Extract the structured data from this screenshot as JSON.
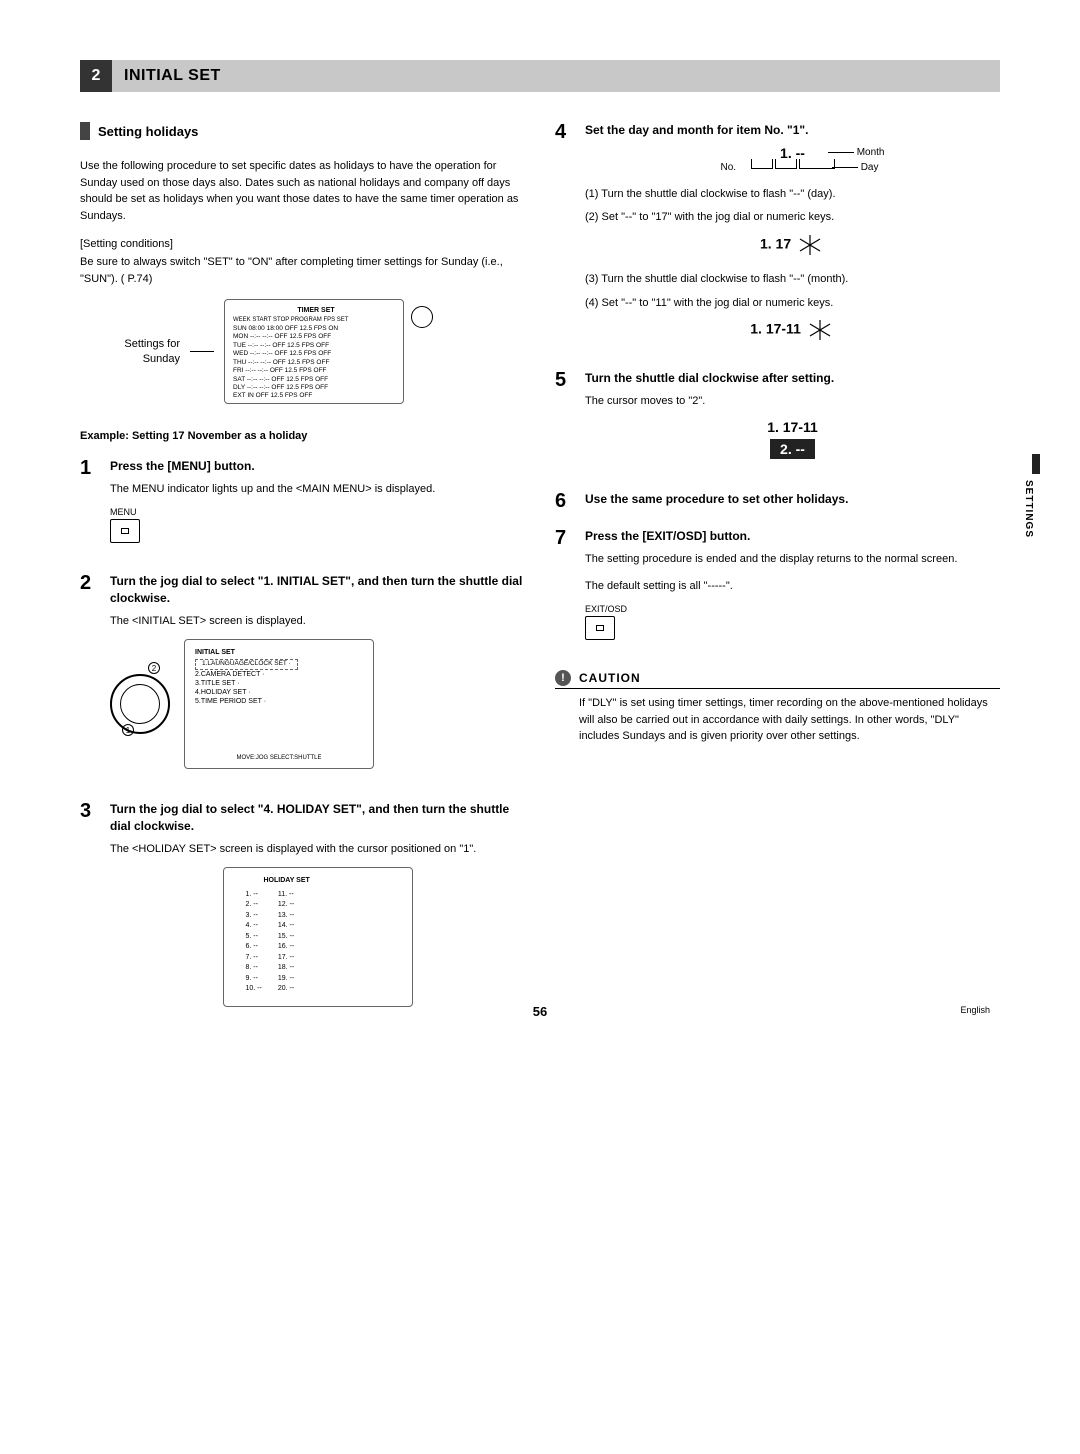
{
  "header": {
    "num": "2",
    "title": "INITIAL SET"
  },
  "section": {
    "heading": "Setting holidays"
  },
  "intro": "Use the following procedure to set specific dates as holidays to have the operation for Sunday used on those days also. Dates such as national holidays and company off days should be set as holidays when you want those dates to have the same timer operation as Sundays.",
  "cond_label": "[Setting conditions]",
  "cond_text": "Be sure to always switch \"SET\" to \"ON\" after completing timer settings for Sunday (i.e., \"SUN\"). (    P.74)",
  "sunday_label": "Settings for Sunday",
  "timer_set_screen": {
    "title": "TIMER SET",
    "head": "WEEK START STOP PROGRAM FPS  SET",
    "rows": [
      "SUN  08:00  18:00  OFF 12.5 FPS ON",
      "MON  --:--  --:--  OFF 12.5 FPS OFF",
      "TUE  --:--  --:--  OFF 12.5 FPS OFF",
      "WED  --:--  --:--  OFF 12.5 FPS OFF",
      "THU  --:--  --:--  OFF 12.5 FPS OFF",
      "FRI  --:--  --:--  OFF 12.5 FPS OFF",
      "SAT  --:--  --:--  OFF 12.5 FPS OFF",
      "DLY  --:--  --:--  OFF 12.5 FPS OFF",
      "EXT  IN OFF 12.5 FPS OFF"
    ]
  },
  "example_title": "Example: Setting 17 November as a holiday",
  "step1": {
    "title": "Press the [MENU] button.",
    "text": "The MENU indicator lights up and the <MAIN MENU> is displayed.",
    "btn": "MENU"
  },
  "step2": {
    "title": "Turn the jog dial to select \"1. INITIAL SET\", and then turn the shuttle dial clockwise.",
    "text": "The <INITIAL SET> screen is displayed.",
    "screen_title": "INITIAL SET",
    "screen_items": [
      "1.LAUNGUAGE/CLOCK SET  ·",
      "2.CAMERA DETECT  ·",
      "3.TITLE SET  ·",
      "4.HOLIDAY SET  ·",
      "5.TIME PERIOD SET  ·"
    ],
    "screen_foot": "MOVE:JOG  SELECT:SHUTTLE"
  },
  "step3": {
    "title": "Turn the jog dial to select \"4. HOLIDAY SET\", and then turn the shuttle dial clockwise.",
    "text": "The <HOLIDAY SET> screen is displayed with the cursor positioned on \"1\".",
    "screen_title": "HOLIDAY SET",
    "left_col": [
      "1. --",
      "2. --",
      "3. --",
      "4. --",
      "5. --",
      "6. --",
      "7. --",
      "8. --",
      "9. --",
      "10. --"
    ],
    "right_col": [
      "11. --",
      "12. --",
      "13. --",
      "14. --",
      "15. --",
      "16. --",
      "17. --",
      "18. --",
      "19. --",
      "20. --"
    ]
  },
  "step4": {
    "title": "Set the day and month for item No. \"1\".",
    "top_value": "1. --",
    "label_no": "No.",
    "label_month": "Month",
    "label_day": "Day",
    "li1": "(1)  Turn the shuttle dial clockwise to flash \"--\" (day).",
    "li2": "(2)  Set \"--\" to \"17\" with the jog dial or numeric keys.",
    "val2": "1. 17",
    "li3": "(3)  Turn the shuttle dial clockwise to flash \"--\" (month).",
    "li4": "(4)  Set \"--\" to \"11\" with the jog dial or numeric keys.",
    "val4": "1. 17-11"
  },
  "step5": {
    "title": "Turn the shuttle dial clockwise after setting.",
    "text": "The cursor moves to \"2\".",
    "top": "1. 17-11",
    "cursor": "2. --"
  },
  "step6": {
    "title": "Use the same procedure to set other holidays."
  },
  "step7": {
    "title": "Press the [EXIT/OSD] button.",
    "text1": "The setting procedure is ended and the display returns to the normal screen.",
    "text2": "The default setting is all \"-----\".",
    "btn": "EXIT/OSD"
  },
  "caution": {
    "title": "CAUTION",
    "body": "If \"DLY\" is set using timer settings, timer recording on the above-mentioned holidays will also be carried out in accordance with daily settings. In other words, \"DLY\" includes Sundays and is given priority over other settings."
  },
  "side_tab": "SETTINGS",
  "page_num": "56",
  "lang": "English"
}
